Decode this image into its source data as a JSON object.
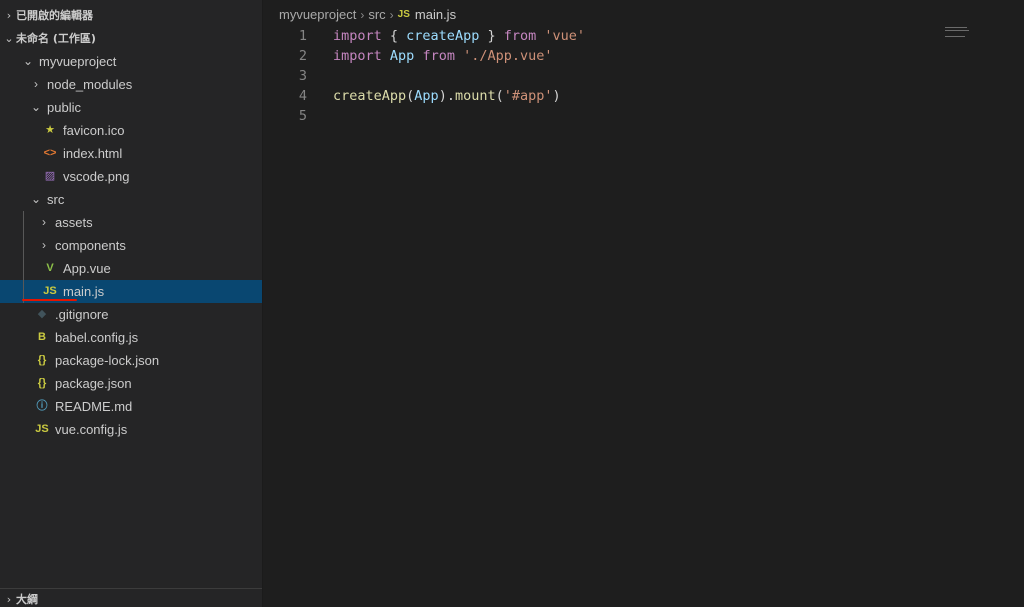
{
  "sidebar": {
    "open_editors_header": "已開啟的編輯器",
    "workspace_header": "未命名 (工作區)",
    "outline_header": "大綱",
    "tree": [
      {
        "label": "myvueproject",
        "chevron": "⌄",
        "icon": "",
        "icon_name": "folder-open"
      },
      {
        "label": "node_modules",
        "chevron": "›",
        "icon": "",
        "icon_name": "folder-closed"
      },
      {
        "label": "public",
        "chevron": "⌄",
        "icon": "",
        "icon_name": "folder-open"
      },
      {
        "label": "favicon.ico",
        "chevron": "",
        "icon": "★",
        "icon_name": "favicon-file-icon",
        "color": "#cbcb41"
      },
      {
        "label": "index.html",
        "chevron": "",
        "icon": "<>",
        "icon_name": "html-file-icon",
        "color": "#e37933"
      },
      {
        "label": "vscode.png",
        "chevron": "",
        "icon": "▨",
        "icon_name": "image-file-icon",
        "color": "#a074c4"
      },
      {
        "label": "src",
        "chevron": "⌄",
        "icon": "",
        "icon_name": "folder-open"
      },
      {
        "label": "assets",
        "chevron": "›",
        "icon": "",
        "icon_name": "folder-closed"
      },
      {
        "label": "components",
        "chevron": "›",
        "icon": "",
        "icon_name": "folder-closed"
      },
      {
        "label": "App.vue",
        "chevron": "",
        "icon": "V",
        "icon_name": "vue-file-icon",
        "color": "#8dc149"
      },
      {
        "label": "main.js",
        "chevron": "",
        "icon": "JS",
        "icon_name": "js-file-icon",
        "color": "#cbcb41",
        "selected": true
      },
      {
        "label": ".gitignore",
        "chevron": "",
        "icon": "◆",
        "icon_name": "git-file-icon",
        "color": "#41535b"
      },
      {
        "label": "babel.config.js",
        "chevron": "",
        "icon": "B",
        "icon_name": "babel-file-icon",
        "color": "#cbcb41"
      },
      {
        "label": "package-lock.json",
        "chevron": "",
        "icon": "{}",
        "icon_name": "json-file-icon",
        "color": "#cbcb41"
      },
      {
        "label": "package.json",
        "chevron": "",
        "icon": "{}",
        "icon_name": "json-file-icon",
        "color": "#cbcb41"
      },
      {
        "label": "README.md",
        "chevron": "",
        "icon": "ⓘ",
        "icon_name": "info-file-icon",
        "color": "#519aba"
      },
      {
        "label": "vue.config.js",
        "chevron": "",
        "icon": "JS",
        "icon_name": "js-file-icon",
        "color": "#cbcb41"
      }
    ]
  },
  "breadcrumb": {
    "project": "myvueproject",
    "folder": "src",
    "file_icon": "JS",
    "file": "main.js"
  },
  "code": {
    "line_numbers": [
      "1",
      "2",
      "3",
      "4",
      "5"
    ],
    "lines": [
      [
        [
          "kw",
          "import"
        ],
        [
          "pun",
          " { "
        ],
        [
          "id",
          "createApp"
        ],
        [
          "pun",
          " } "
        ],
        [
          "kw",
          "from"
        ],
        [
          "pun",
          " "
        ],
        [
          "str",
          "'vue'"
        ]
      ],
      [
        [
          "kw",
          "import"
        ],
        [
          "pun",
          " "
        ],
        [
          "id",
          "App"
        ],
        [
          "pun",
          " "
        ],
        [
          "kw",
          "from"
        ],
        [
          "pun",
          " "
        ],
        [
          "str",
          "'./App.vue'"
        ]
      ],
      [],
      [
        [
          "fn",
          "createApp"
        ],
        [
          "pun",
          "("
        ],
        [
          "id",
          "App"
        ],
        [
          "pun",
          ")."
        ],
        [
          "fn",
          "mount"
        ],
        [
          "pun",
          "("
        ],
        [
          "str",
          "'#app'"
        ],
        [
          "pun",
          ")"
        ]
      ],
      []
    ]
  },
  "colors": {
    "selection": "#094771",
    "keyword": "#c586c0",
    "identifier": "#9cdcfe",
    "function": "#dcdcaa",
    "string": "#ce9178"
  }
}
